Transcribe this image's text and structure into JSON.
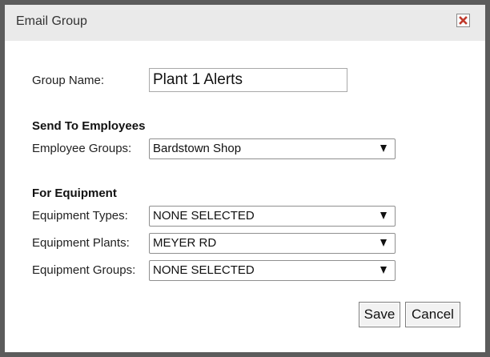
{
  "dialog": {
    "title": "Email Group",
    "close_icon": "close-icon"
  },
  "form": {
    "group_name_label": "Group Name:",
    "group_name_value": "Plant 1 Alerts",
    "send_to_heading": "Send To Employees",
    "employee_groups_label": "Employee Groups:",
    "employee_groups_value": "Bardstown Shop",
    "for_equipment_heading": "For Equipment",
    "equipment_types_label": "Equipment Types:",
    "equipment_types_value": "NONE SELECTED",
    "equipment_plants_label": "Equipment Plants:",
    "equipment_plants_value": "MEYER RD",
    "equipment_groups_label": "Equipment Groups:",
    "equipment_groups_value": "NONE SELECTED",
    "dropdown_icon": "triangle-down-icon"
  },
  "buttons": {
    "save_label": "Save",
    "cancel_label": "Cancel"
  },
  "colors": {
    "close_x": "#c0392b",
    "titlebar": "#eaeaea",
    "backdrop": "#5c5c5c"
  }
}
